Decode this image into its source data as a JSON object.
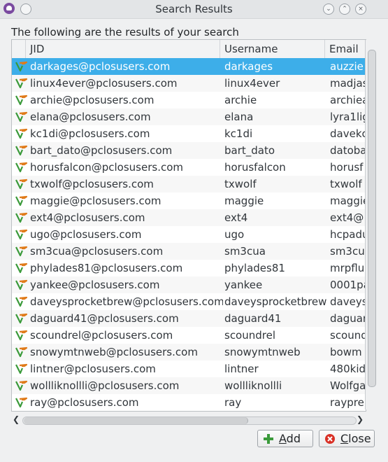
{
  "window": {
    "title": "Search Results"
  },
  "heading": "The following are the results of your search",
  "table": {
    "headers": {
      "jid": "JID",
      "username": "Username",
      "email": "Email"
    },
    "rows": [
      {
        "jid": "darkages@pclosusers.com",
        "username": "darkages",
        "email": "auzzie"
      },
      {
        "jid": "linux4ever@pclosusers.com",
        "username": "linux4ever",
        "email": "madjas"
      },
      {
        "jid": "archie@pclosusers.com",
        "username": "archie",
        "email": "archiea"
      },
      {
        "jid": "elana@pclosusers.com",
        "username": "elana",
        "email": "lyra1lig"
      },
      {
        "jid": "kc1di@pclosusers.com",
        "username": "kc1di",
        "email": "davekc"
      },
      {
        "jid": "bart_dato@pclosusers.com",
        "username": "bart_dato",
        "email": "datobar"
      },
      {
        "jid": "horusfalcon@pclosusers.com",
        "username": "horusfalcon",
        "email": "horusf"
      },
      {
        "jid": "txwolf@pclosusers.com",
        "username": "txwolf",
        "email": "txwolf"
      },
      {
        "jid": "maggie@pclosusers.com",
        "username": "maggie",
        "email": "maggie"
      },
      {
        "jid": "ext4@pclosusers.com",
        "username": "ext4",
        "email": "ext4@"
      },
      {
        "jid": "ugo@pclosusers.com",
        "username": "ugo",
        "email": "hcpadu"
      },
      {
        "jid": "sm3cua@pclosusers.com",
        "username": "sm3cua",
        "email": "sm3cu"
      },
      {
        "jid": "phylades81@pclosusers.com",
        "username": "phylades81",
        "email": "mrpflu"
      },
      {
        "jid": "yankee@pclosusers.com",
        "username": "yankee",
        "email": "0001pa"
      },
      {
        "jid": "daveysprocketbrew@pclosusers.com",
        "username": "daveysprocketbrew",
        "email": "daveys"
      },
      {
        "jid": "daguard41@pclosusers.com",
        "username": "daguard41",
        "email": "daguar"
      },
      {
        "jid": "scoundrel@pclosusers.com",
        "username": "scoundrel",
        "email": "scound"
      },
      {
        "jid": "snowymtnweb@pclosusers.com",
        "username": "snowymtnweb",
        "email": "bowm"
      },
      {
        "jid": "lintner@pclosusers.com",
        "username": "lintner",
        "email": "480kid"
      },
      {
        "jid": "wollliknollli@pclosusers.com",
        "username": "wollliknollli",
        "email": "Wolfga"
      },
      {
        "jid": "ray@pclosusers.com",
        "username": "ray",
        "email": "raypre"
      }
    ],
    "selected_index": 0
  },
  "buttons": {
    "add": "Add",
    "close": "Close"
  },
  "icons": {
    "row": "vcard-icon",
    "add": "plus-icon",
    "close": "cancel-icon"
  },
  "colors": {
    "selection": "#3daee9",
    "add_icon": "#3a9a3a",
    "close_icon": "#d93025"
  }
}
